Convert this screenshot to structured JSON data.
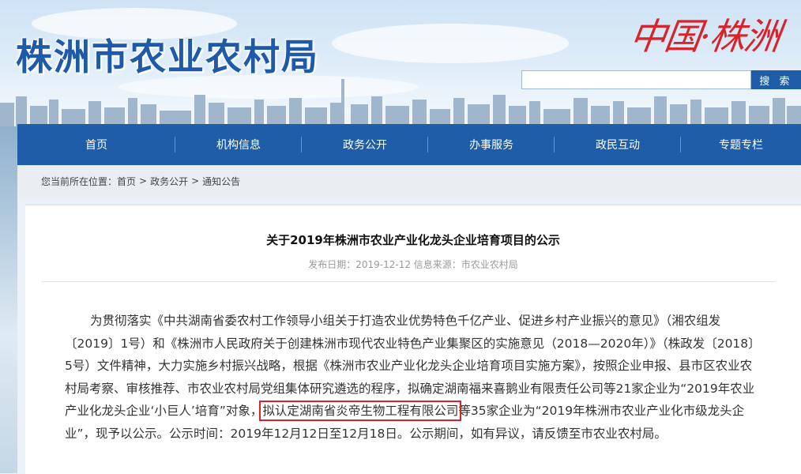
{
  "header": {
    "site_title": "株洲市农业农村局",
    "brand_text": "中国·株洲",
    "search": {
      "placeholder": "",
      "button_label": "搜 索"
    }
  },
  "nav": {
    "items": [
      {
        "label": "首页"
      },
      {
        "label": "机构信息"
      },
      {
        "label": "政务公开"
      },
      {
        "label": "办事服务"
      },
      {
        "label": "政民互动"
      },
      {
        "label": "专题专栏"
      }
    ]
  },
  "breadcrumb": {
    "prefix": "您当前所在位置：",
    "items": [
      "首页",
      "政务公开",
      "通知公告"
    ],
    "separator": ">"
  },
  "article": {
    "title": "关于2019年株洲市农业产业化龙头企业培育项目的公示",
    "meta": "发布日期：2019-12-12   信息来源：市农业农村局",
    "body_before": "为贯彻落实《中共湖南省委农村工作领导小组关于打造农业优势特色千亿产业、促进乡村产业振兴的意见》（湘农组发〔2019〕1号）和《株洲市人民政府关于创建株洲市现代农业特色产业集聚区的实施意见（2018—2020年）》（株政发〔2018〕5号）文件精神，大力实施乡村振兴战略，根据《株洲市农业产业化龙头企业培育项目实施方案》，按照企业申报、县市区农业农村局考察、审核推荐、市农业农村局党组集体研究遴选的程序，拟确定湖南福来喜鹅业有限责任公司等21家企业为“2019年农业产业化龙头企业‘小巨人’培育”对象，",
    "body_highlight": "拟认定湖南省炎帝生物工程有限公司",
    "body_after": "等35家企业为“2019年株洲市农业产业化市级龙头企业”，现予以公示。公示时间：2019年12月12日至12月18日。公示期间，如有异议，请反馈至市农业农村局。"
  },
  "colors": {
    "nav_bg": "#1f5da8",
    "title_blue": "#1e5aa8",
    "brand_red": "#d8232a",
    "highlight_box": "#d9232a"
  }
}
